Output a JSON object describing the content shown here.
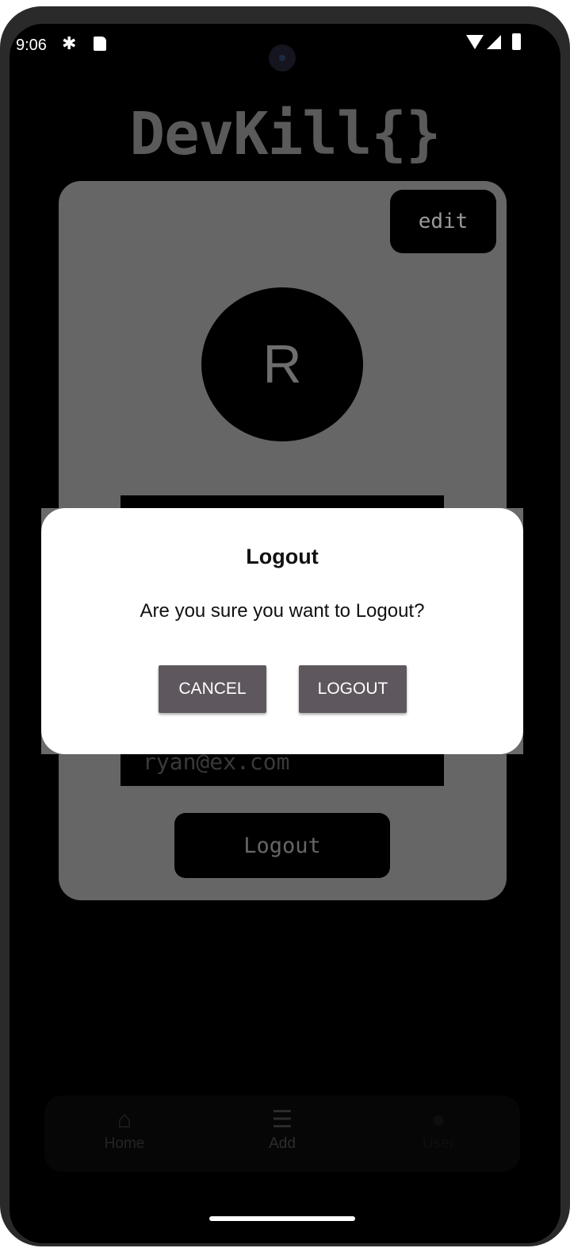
{
  "status_bar": {
    "time": "9:06",
    "icons": [
      "gear-icon",
      "sdcard-icon",
      "wifi-icon",
      "signal-icon",
      "battery-icon"
    ]
  },
  "app": {
    "title": "DevKill{}"
  },
  "profile": {
    "edit_label": "edit",
    "avatar_initial": "R",
    "email": "ryan@ex.com",
    "logout_label": "Logout"
  },
  "dialog": {
    "title": "Logout",
    "message": "Are you sure you want to Logout?",
    "cancel_label": "CANCEL",
    "confirm_label": "LOGOUT"
  },
  "nav": {
    "items": [
      {
        "label": "Home",
        "icon": "home-icon"
      },
      {
        "label": "Add",
        "icon": "clipboard-icon"
      },
      {
        "label": "User",
        "icon": "user-icon"
      }
    ]
  },
  "colors": {
    "card": "#666666",
    "dialog_button": "#5e585e",
    "dialog": "#ffffff",
    "background": "#000000"
  }
}
